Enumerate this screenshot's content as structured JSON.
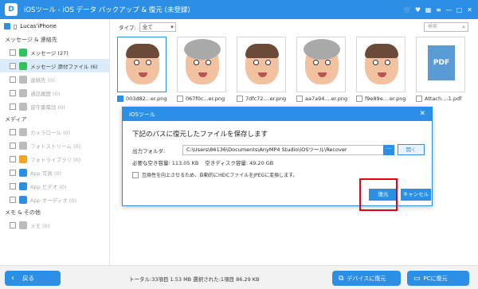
{
  "app": {
    "title": "iOSツール - iOS データ バックアップ & 復元 (未登録)",
    "logo": "D"
  },
  "window_controls": [
    "🛒",
    "♥",
    "▦",
    "≡",
    "—",
    "□",
    "✕"
  ],
  "device": {
    "name": "Lucas'iPhone"
  },
  "sidebar": {
    "sections": [
      {
        "label": "メッセージ & 連絡先",
        "items": [
          {
            "label": "メッセージ (27)",
            "color": "#2ec45a",
            "dim": false,
            "active": false
          },
          {
            "label": "メッセージ 添付ファイル (6)",
            "color": "#2ec45a",
            "dim": false,
            "active": true
          },
          {
            "label": "連絡先 (0)",
            "color": "#bbbbbb",
            "dim": true,
            "active": false
          },
          {
            "label": "通話履歴 (0)",
            "color": "#bbbbbb",
            "dim": true,
            "active": false
          },
          {
            "label": "留守番電話 (0)",
            "color": "#bbbbbb",
            "dim": true,
            "active": false
          }
        ]
      },
      {
        "label": "メディア",
        "items": [
          {
            "label": "カメラロール (0)",
            "color": "#bbbbbb",
            "dim": true,
            "active": false
          },
          {
            "label": "フォトストリーム (0)",
            "color": "#bbbbbb",
            "dim": true,
            "active": false
          },
          {
            "label": "フォトライブラリ (0)",
            "color": "#f5a623",
            "dim": true,
            "active": false
          },
          {
            "label": "App 写真 (0)",
            "color": "#2b8fe6",
            "dim": true,
            "active": false
          },
          {
            "label": "App ビデオ (0)",
            "color": "#2b8fe6",
            "dim": true,
            "active": false
          },
          {
            "label": "App オーディオ (0)",
            "color": "#2b8fe6",
            "dim": true,
            "active": false
          }
        ]
      },
      {
        "label": "メモ & その他",
        "items": [
          {
            "label": "メモ (0)",
            "color": "#bbbbbb",
            "dim": true,
            "active": false
          }
        ]
      }
    ]
  },
  "toolbar": {
    "type_label": "タイプ:",
    "type_value": "全て",
    "search_placeholder": "検索"
  },
  "thumbnails": [
    {
      "name": "003d82...er.png",
      "kind": "face",
      "checked": true,
      "selected": true
    },
    {
      "name": "067f0c...er.png",
      "kind": "smoke",
      "checked": false,
      "selected": false
    },
    {
      "name": "7dfc72....er.png",
      "kind": "face",
      "checked": false,
      "selected": false
    },
    {
      "name": "aa7a94....er.png",
      "kind": "smoke",
      "checked": false,
      "selected": false
    },
    {
      "name": "f9e89e....er.png",
      "kind": "face",
      "checked": false,
      "selected": false
    },
    {
      "name": "Attach...-1.pdf",
      "kind": "pdf",
      "checked": false,
      "selected": false
    }
  ],
  "dialog": {
    "title": "iOSツール",
    "heading": "下記のパスに復元したファイルを保存します",
    "output_label": "出力フォルダ:",
    "output_path": "C:\\Users\\86136\\Documents\\AnyMP4 Studio\\iOSツール\\Recover",
    "dots_label": "···",
    "open_label": "開く",
    "required_label": "必要な空き容量: 113.05 KB",
    "free_label": "空きディスク容量: 49.20 GB",
    "heic_label": "互換性を向上させるため、自動的にHEICファイルをJPEGに変換します。",
    "restore_label": "復元",
    "cancel_label": "キャンセル",
    "close_icon": "✕"
  },
  "footer": {
    "back_label": "戻る",
    "back_icon": "‹",
    "stats": "トータル:33項目 1.53 MB   選択された:1項目 86.29 KB",
    "device_restore_label": "デバイスに復元",
    "pc_restore_label": "PCに復元"
  }
}
